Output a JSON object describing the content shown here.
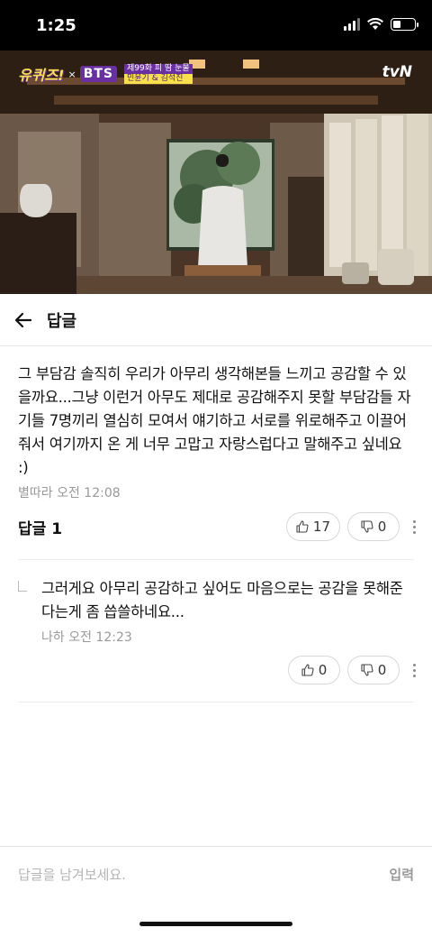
{
  "status_bar": {
    "time": "1:25"
  },
  "video": {
    "show_logo": "유퀴즈!",
    "collab_x": "×",
    "group_logo": "BTS",
    "episode_line1": "제99화 피 땀 눈물",
    "episode_line2": "민윤기 & 김석진",
    "channel": "tvN"
  },
  "header": {
    "title": "답글"
  },
  "comment": {
    "text": "그 부담감 솔직히 우리가 아무리 생각해본들 느끼고 공감할 수 있을까요...그냥 이런거 아무도 제대로 공감해주지 못할 부담감들 자기들 7명끼리 열심히 모여서 얘기하고 서로를 위로해주고 이끌어줘서 여기까지 온 게 너무 고맙고 자랑스럽다고 말해주고 싶네요 :)",
    "author": "별따라",
    "time": "오전 12:08",
    "reply_label": "답글 1",
    "likes": "17",
    "dislikes": "0"
  },
  "reply": {
    "text": "그러게요 아무리 공감하고 싶어도 마음으로는 공감을 못해준다는게 좀 씁쓸하네요...",
    "author": "나하",
    "time": "오전 12:23",
    "likes": "0",
    "dislikes": "0"
  },
  "input": {
    "placeholder": "답글을 남겨보세요.",
    "submit_label": "입력"
  }
}
